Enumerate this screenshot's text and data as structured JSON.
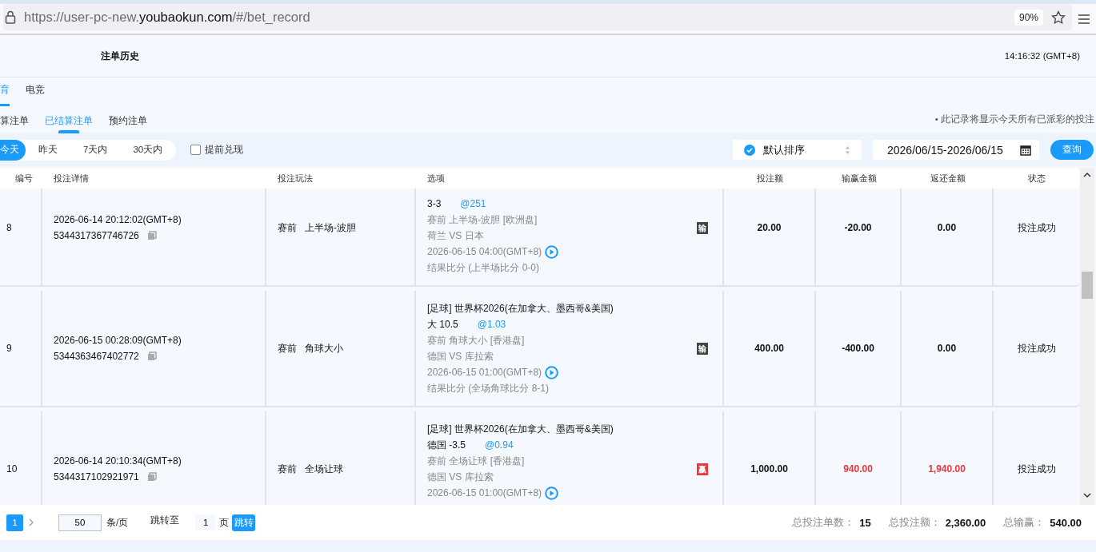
{
  "browser": {
    "url_prefix": "https://user-pc-new.",
    "url_domain": "youbaokun.com",
    "url_path": "/#/bet_record",
    "zoom": "90%"
  },
  "header": {
    "title": "注单历史",
    "clock": "14:16:32 (GMT+8)"
  },
  "tabs": [
    {
      "label": "育",
      "selected": true
    },
    {
      "label": "电竞",
      "selected": false
    }
  ],
  "subtabs": [
    {
      "label": "算注单",
      "selected": false
    },
    {
      "label": "已结算注单",
      "selected": true
    },
    {
      "label": "预约注单",
      "selected": false
    }
  ],
  "note": "• 此记录将显示今天所有已派彩的投注",
  "ranges": [
    {
      "label": "今天",
      "selected": true
    },
    {
      "label": "昨天",
      "selected": false
    },
    {
      "label": "7天内",
      "selected": false
    },
    {
      "label": "30天内",
      "selected": false
    }
  ],
  "early_cashout": {
    "label": "提前兑现",
    "checked": false
  },
  "sort": {
    "value": "默认排序"
  },
  "date_range": {
    "value": "2026/06/15-2026/06/15"
  },
  "query_button": "查询",
  "columns": [
    "编号",
    "投注详情",
    "投注玩法",
    "选项",
    "投注额",
    "输赢金额",
    "返还金额",
    "状态"
  ],
  "rows": [
    {
      "number": "8",
      "time": "2026-06-14 20:12:02(GMT+8)",
      "order_id": "5344317367746726",
      "stage": "赛前",
      "play": "上半场-波胆",
      "pick": "3-3",
      "odds": "@251",
      "market": "赛前 上半场-波胆 [欧洲盘]",
      "match": "荷兰 VS 日本",
      "kickoff": "2026-06-15 04:00(GMT+8)",
      "result": "结果比分 (上半场比分 0-0)",
      "won": false,
      "badge": {
        "text": "输",
        "color": "#444444"
      },
      "stake": "20.00",
      "win_loss": "-20.00",
      "returned": "0.00",
      "status": "投注成功"
    },
    {
      "number": "9",
      "time": "2026-06-15 00:28:09(GMT+8)",
      "order_id": "5344363467402772",
      "stage": "赛前",
      "play": "角球大小",
      "league": "[足球] 世界杯2026(在加拿大、墨西哥&美国)",
      "pick": "大 10.5",
      "odds": "@1.03",
      "market": "赛前 角球大小 [香港盘]",
      "match": "德国 VS 库拉索",
      "kickoff": "2026-06-15 01:00(GMT+8)",
      "result": "结果比分 (全场角球比分 8-1)",
      "won": false,
      "badge": {
        "text": "输",
        "color": "#444444"
      },
      "stake": "400.00",
      "win_loss": "-400.00",
      "returned": "0.00",
      "status": "投注成功"
    },
    {
      "number": "10",
      "time": "2026-06-14 20:10:34(GMT+8)",
      "order_id": "5344317102921971",
      "stage": "赛前",
      "play": "全场让球",
      "league": "[足球] 世界杯2026(在加拿大、墨西哥&美国)",
      "pick": "德国 -3.5",
      "odds": "@0.94",
      "market": "赛前 全场让球 [香港盘]",
      "match": "德国 VS 库拉索",
      "kickoff": "2026-06-15 01:00(GMT+8)",
      "won": true,
      "badge": {
        "text": "赢",
        "color": "#e8383d"
      },
      "stake": "1,000.00",
      "win_loss": "940.00",
      "returned": "1,940.00",
      "status": "投注成功"
    }
  ],
  "pagination": {
    "current_page": "1",
    "page_size": "50",
    "page_size_unit": "条/页",
    "jump_label": "跳转至",
    "jump_value": "1",
    "jump_unit": "页",
    "jump_button": "跳转"
  },
  "summary": [
    {
      "label": "总投注单数：",
      "value": "15"
    },
    {
      "label": "总投注额：",
      "value": "2,360.00"
    },
    {
      "label": "总输赢：",
      "value": "540.00"
    }
  ]
}
